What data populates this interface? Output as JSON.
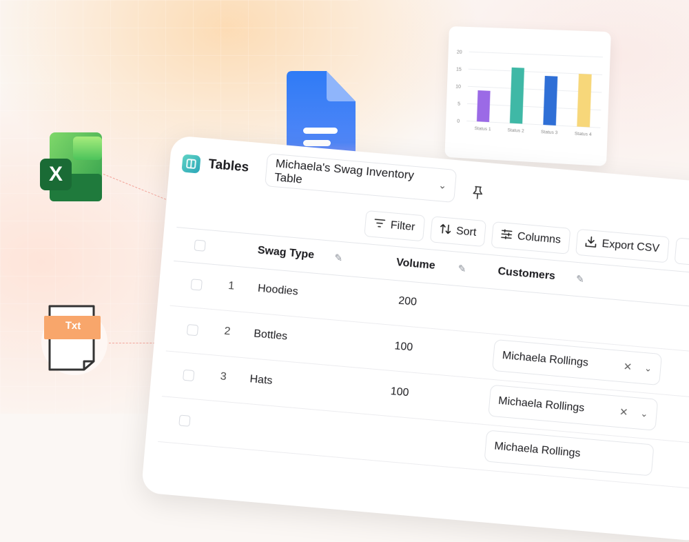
{
  "app": {
    "title": "Tables"
  },
  "table_selector": {
    "value": "Michaela's Swag Inventory Table"
  },
  "toolbar": {
    "filter_label": "Filter",
    "sort_label": "Sort",
    "columns_label": "Columns",
    "export_label": "Export CSV"
  },
  "columns": {
    "swag_type": "Swag Type",
    "volume": "Volume",
    "customers": "Customers"
  },
  "rows": [
    {
      "num": "1",
      "type": "Hoodies",
      "volume": "200",
      "customer": ""
    },
    {
      "num": "2",
      "type": "Bottles",
      "volume": "100",
      "customer": "Michaela Rollings"
    },
    {
      "num": "3",
      "type": "Hats",
      "volume": "100",
      "customer": "Michaela Rollings"
    },
    {
      "num": "",
      "type": "",
      "volume": "",
      "customer": "Michaela Rollings"
    }
  ],
  "icons": {
    "excel": "excel-icon",
    "txt": "txt-file-icon",
    "docs": "google-docs-icon",
    "pin": "pin-icon",
    "filter": "filter-icon",
    "sort": "sort-icon",
    "columns": "columns-icon",
    "export": "download-icon"
  },
  "txt_icon": {
    "label": "Txt"
  },
  "chart_data": {
    "type": "bar",
    "categories": [
      "Status 1",
      "Status 2",
      "Status 3",
      "Status 4"
    ],
    "values": [
      9,
      16,
      14,
      15
    ],
    "yticks": [
      "20",
      "15",
      "10",
      "5",
      "0"
    ],
    "ylim": [
      0,
      20
    ],
    "colors": [
      "#9b6ae6",
      "#3fb8a6",
      "#2f6fd6",
      "#f7d77a"
    ],
    "title": "",
    "xlabel": "",
    "ylabel": ""
  },
  "colors": {
    "accent_teal": "#2ba6b8",
    "dashed_line": "#f3a59b"
  }
}
